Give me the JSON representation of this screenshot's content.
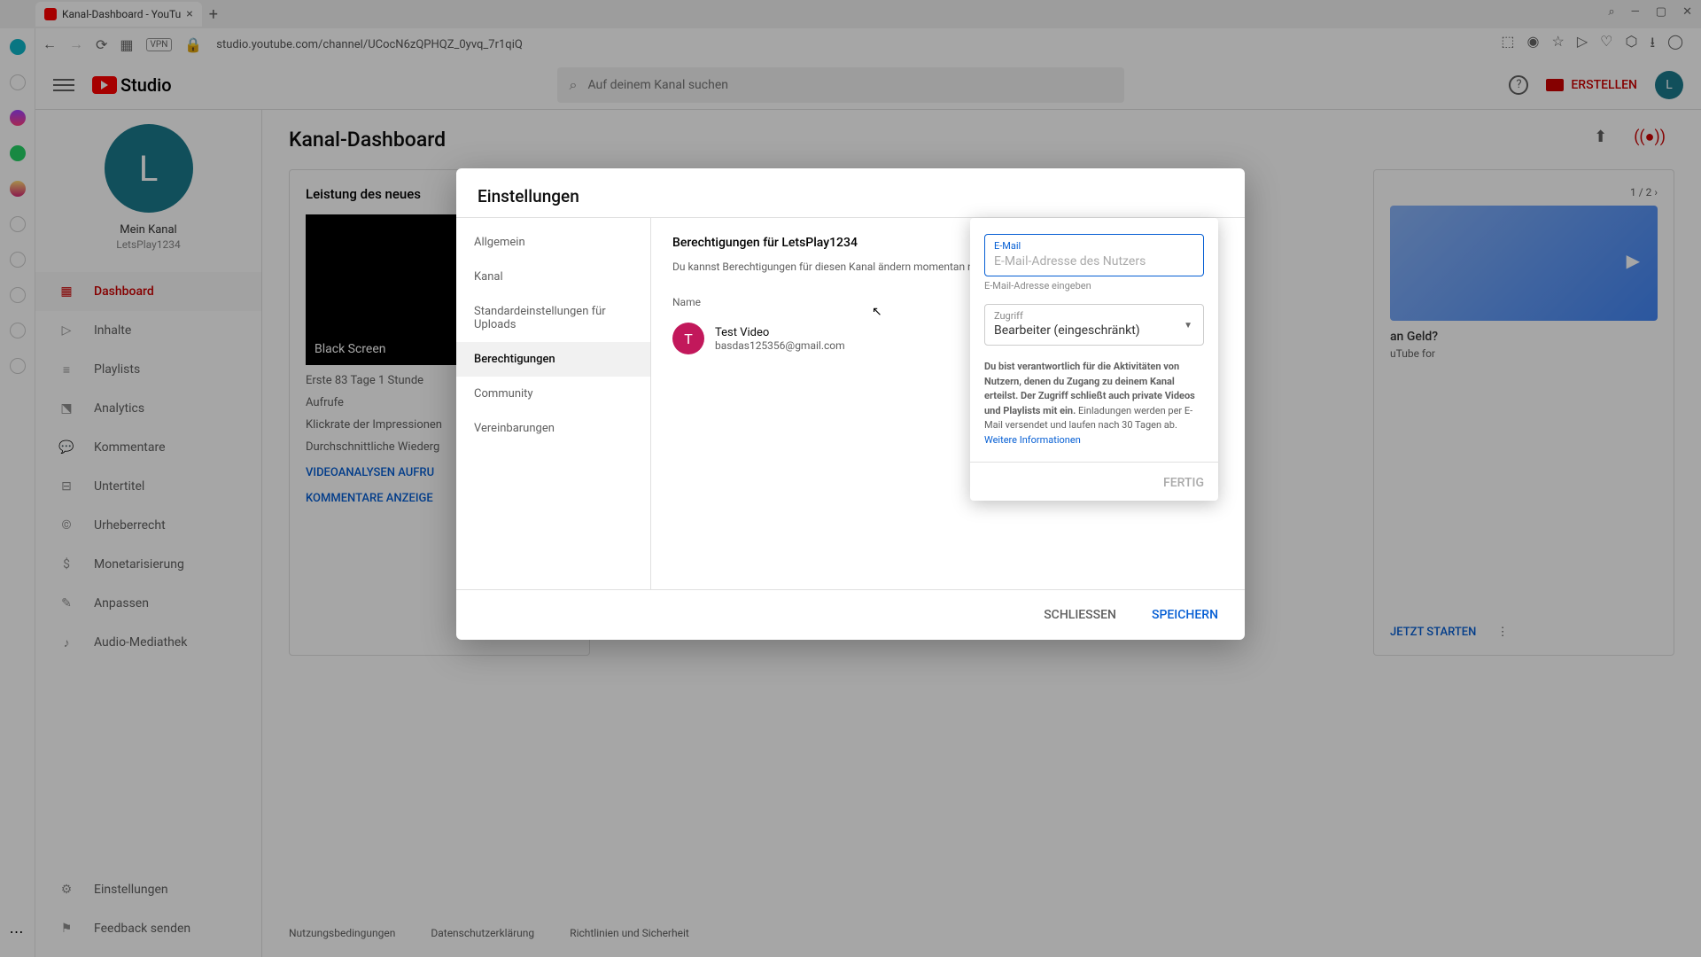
{
  "browser": {
    "tab_title": "Kanal-Dashboard - YouTu",
    "url": "studio.youtube.com/channel/UCocN6zQPHQZ_0yvq_7r1qiQ",
    "vpn": "VPN"
  },
  "header": {
    "logo_text": "Studio",
    "search_placeholder": "Auf deinem Kanal suchen",
    "create": "ERSTELLEN",
    "avatar_letter": "L"
  },
  "sidebar": {
    "channel_avatar_letter": "L",
    "channel_label": "Mein Kanal",
    "channel_name": "LetsPlay1234",
    "items": [
      {
        "label": "Dashboard"
      },
      {
        "label": "Inhalte"
      },
      {
        "label": "Playlists"
      },
      {
        "label": "Analytics"
      },
      {
        "label": "Kommentare"
      },
      {
        "label": "Untertitel"
      },
      {
        "label": "Urheberrecht"
      },
      {
        "label": "Monetarisierung"
      },
      {
        "label": "Anpassen"
      },
      {
        "label": "Audio-Mediathek"
      }
    ],
    "bottom": [
      {
        "label": "Einstellungen"
      },
      {
        "label": "Feedback senden"
      }
    ]
  },
  "main": {
    "title": "Kanal-Dashboard",
    "card1": {
      "title": "Leistung des neues",
      "thumb_label": "Black Screen",
      "line1": "Erste 83 Tage 1 Stunde",
      "line2": "Aufrufe",
      "line3": "Klickrate der Impressionen",
      "line4": "Durchschnittliche Wiederg",
      "link1": "VIDEOANALYSEN AUFRU",
      "link2": "KOMMENTARE ANZEIGE"
    },
    "card3": {
      "pager": "1 / 2",
      "promo_title": "an Geld?",
      "promo_desc": "uTube for",
      "btn": "JETZT STARTEN"
    },
    "footer": [
      "Nutzungsbedingungen",
      "Datenschutzerklärung",
      "Richtlinien und Sicherheit"
    ]
  },
  "modal": {
    "title": "Einstellungen",
    "nav": [
      "Allgemein",
      "Kanal",
      "Standardeinstellungen für Uploads",
      "Berechtigungen",
      "Community",
      "Vereinbarungen"
    ],
    "content": {
      "title": "Berechtigungen für LetsPlay1234",
      "desc": "Du kannst Berechtigungen für diesen Kanal ändern momentan noch nicht für alle Kanalfunktionen und",
      "col": "Name",
      "user_letter": "T",
      "user_name": "Test Video",
      "user_email": "basdas125356@gmail.com"
    },
    "close": "SCHLIESSEN",
    "save": "SPEICHERN"
  },
  "popover": {
    "email_label": "E-Mail",
    "email_placeholder": "E-Mail-Adresse des Nutzers",
    "email_helper": "E-Mail-Adresse eingeben",
    "access_label": "Zugriff",
    "access_value": "Bearbeiter (eingeschränkt)",
    "disclaimer_bold": "Du bist verantwortlich für die Aktivitäten von Nutzern, denen du Zugang zu deinem Kanal erteilst. Der Zugriff schließt auch private Videos und Playlists mit ein.",
    "disclaimer_rest": " Einladungen werden per E-Mail versendet und laufen nach 30 Tagen ab.",
    "learn_more": "Weitere Informationen",
    "done": "FERTIG"
  }
}
